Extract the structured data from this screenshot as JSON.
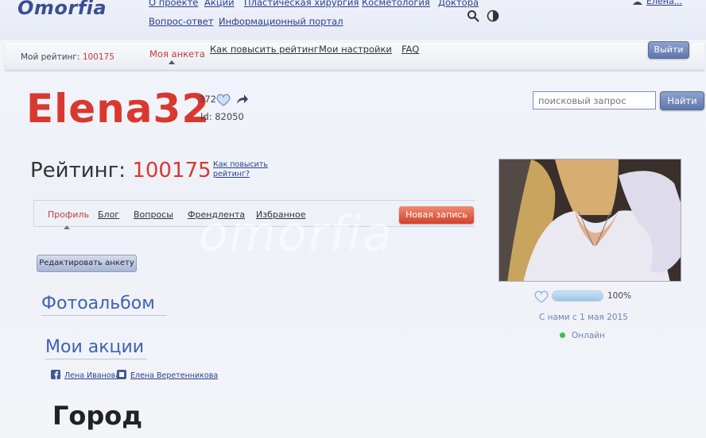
{
  "header": {
    "logo": "Omorfia",
    "nav_row1": [
      "О проекте",
      "Акции",
      "Пластическая хирургия",
      "Косметология",
      "Доктора"
    ],
    "nav_row2": [
      "Вопрос-ответ",
      "Информационный портал"
    ],
    "user_label": "Елена..."
  },
  "subbar": {
    "rating_label": "Мой рейтинг:",
    "rating_value": "100175",
    "tabs": {
      "active": "Моя анкета",
      "raise": "Как повысить рейтинг",
      "settings": "Мои настройки",
      "faq": "FAQ"
    },
    "logout": "Выйти"
  },
  "profile": {
    "username": "Elena32",
    "likes": "372",
    "id_text": "Id: 82050",
    "rating_label": "Рейтинг:",
    "rating_value": "100175",
    "howto": "Как повысить рейтинг?"
  },
  "search": {
    "placeholder": "поисковый запрос",
    "button": "Найти"
  },
  "tabs": {
    "profile": "Профиль",
    "blog": "Блог",
    "questions": "Вопросы",
    "friendlist": "Френдлента",
    "favorites": "Избранное",
    "new_post": "Новая запись"
  },
  "watermark": "omorfia",
  "edit_button": "Редактировать анкету",
  "sections": {
    "photo": "Фотоальбом",
    "actions": "Мои акции",
    "city": "Город"
  },
  "friends": [
    "Лена Иванова",
    "Елена Веретенникова"
  ],
  "side": {
    "percent_value": 100,
    "percent": "100%",
    "since": "С нами с 1 мая 2015",
    "status": "Онлайн"
  },
  "colors": {
    "accent_red": "#d8392f",
    "link_blue": "#2a3f8f",
    "online_green": "#3fbf4a"
  }
}
